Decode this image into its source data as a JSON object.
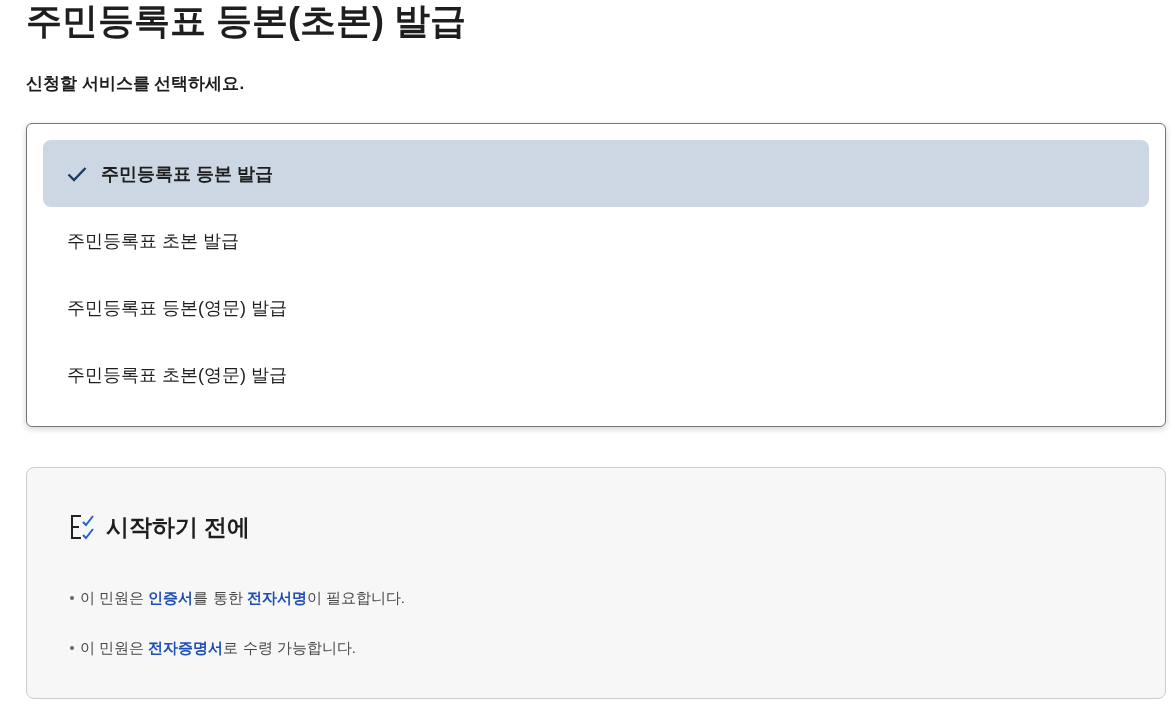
{
  "page": {
    "title": "주민등록표 등본(초본) 발급",
    "prompt": "신청할 서비스를 선택하세요."
  },
  "services": [
    {
      "label": "주민등록표 등본 발급",
      "selected": true
    },
    {
      "label": "주민등록표 초본 발급",
      "selected": false
    },
    {
      "label": "주민등록표 등본(영문) 발급",
      "selected": false
    },
    {
      "label": "주민등록표 초본(영문) 발급",
      "selected": false
    }
  ],
  "notice": {
    "heading": "시작하기 전에",
    "items": [
      "이 민원은 **인증서**를 통한 **전자서명**이 필요합니다.",
      "이 민원은 **전자증명서**로 수령 가능합니다."
    ]
  }
}
